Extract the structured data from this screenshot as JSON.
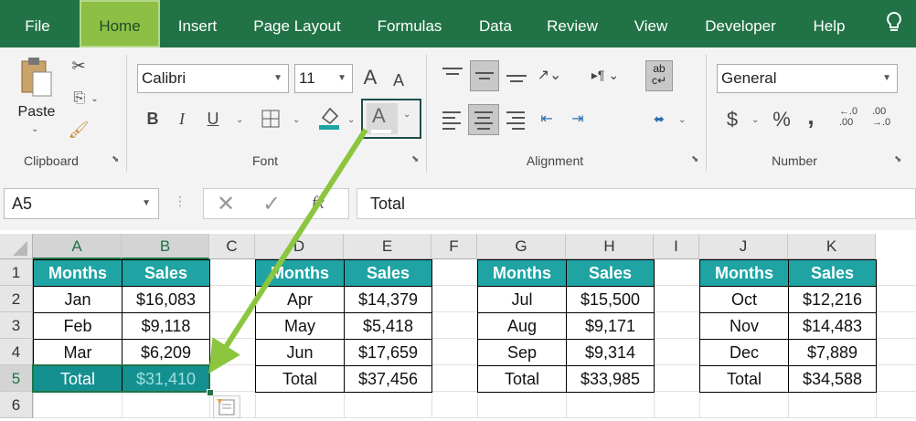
{
  "menu": {
    "tabs": [
      "File",
      "Home",
      "Insert",
      "Page Layout",
      "Formulas",
      "Data",
      "Review",
      "View",
      "Developer",
      "Help"
    ],
    "active": "Home"
  },
  "ribbon": {
    "clipboard": {
      "paste_label": "Paste",
      "group_label": "Clipboard"
    },
    "font": {
      "font_name": "Calibri",
      "font_size": "11",
      "bold": "B",
      "italic": "I",
      "underline": "U",
      "font_color_glyph": "A",
      "grow": "A",
      "shrink": "A",
      "group_label": "Font"
    },
    "alignment": {
      "group_label": "Alignment",
      "wrap_glyph": "ab\nc"
    },
    "number": {
      "format": "General",
      "currency": "$",
      "percent": "%",
      "comma": ",",
      "group_label": "Number",
      "inc_dec": ".0\n.00",
      "dec_dec": ".00\n.0"
    }
  },
  "formula_bar": {
    "name_box": "A5",
    "fx": "fx",
    "content": "Total"
  },
  "columns": [
    "A",
    "B",
    "C",
    "D",
    "E",
    "F",
    "G",
    "H",
    "I",
    "J",
    "K"
  ],
  "rows": [
    "1",
    "2",
    "3",
    "4",
    "5",
    "6"
  ],
  "tables": [
    {
      "headers": [
        "Months",
        "Sales"
      ],
      "rows": [
        [
          "Jan",
          "$16,083"
        ],
        [
          "Feb",
          "$9,118"
        ],
        [
          "Mar",
          "$6,209"
        ],
        [
          "Total",
          "$31,410"
        ]
      ]
    },
    {
      "headers": [
        "Months",
        "Sales"
      ],
      "rows": [
        [
          "Apr",
          "$14,379"
        ],
        [
          "May",
          "$5,418"
        ],
        [
          "Jun",
          "$17,659"
        ],
        [
          "Total",
          "$37,456"
        ]
      ]
    },
    {
      "headers": [
        "Months",
        "Sales"
      ],
      "rows": [
        [
          "Jul",
          "$15,500"
        ],
        [
          "Aug",
          "$9,171"
        ],
        [
          "Sep",
          "$9,314"
        ],
        [
          "Total",
          "$33,985"
        ]
      ]
    },
    {
      "headers": [
        "Months",
        "Sales"
      ],
      "rows": [
        [
          "Oct",
          "$12,216"
        ],
        [
          "Nov",
          "$14,483"
        ],
        [
          "Dec",
          "$7,889"
        ],
        [
          "Total",
          "$34,588"
        ]
      ]
    }
  ],
  "colors": {
    "ribbon_green": "#217346",
    "active_tab": "#8dbf44",
    "header_teal": "#1fa3a3",
    "selected_teal": "#13908f",
    "arrow_green": "#8cc63f"
  }
}
